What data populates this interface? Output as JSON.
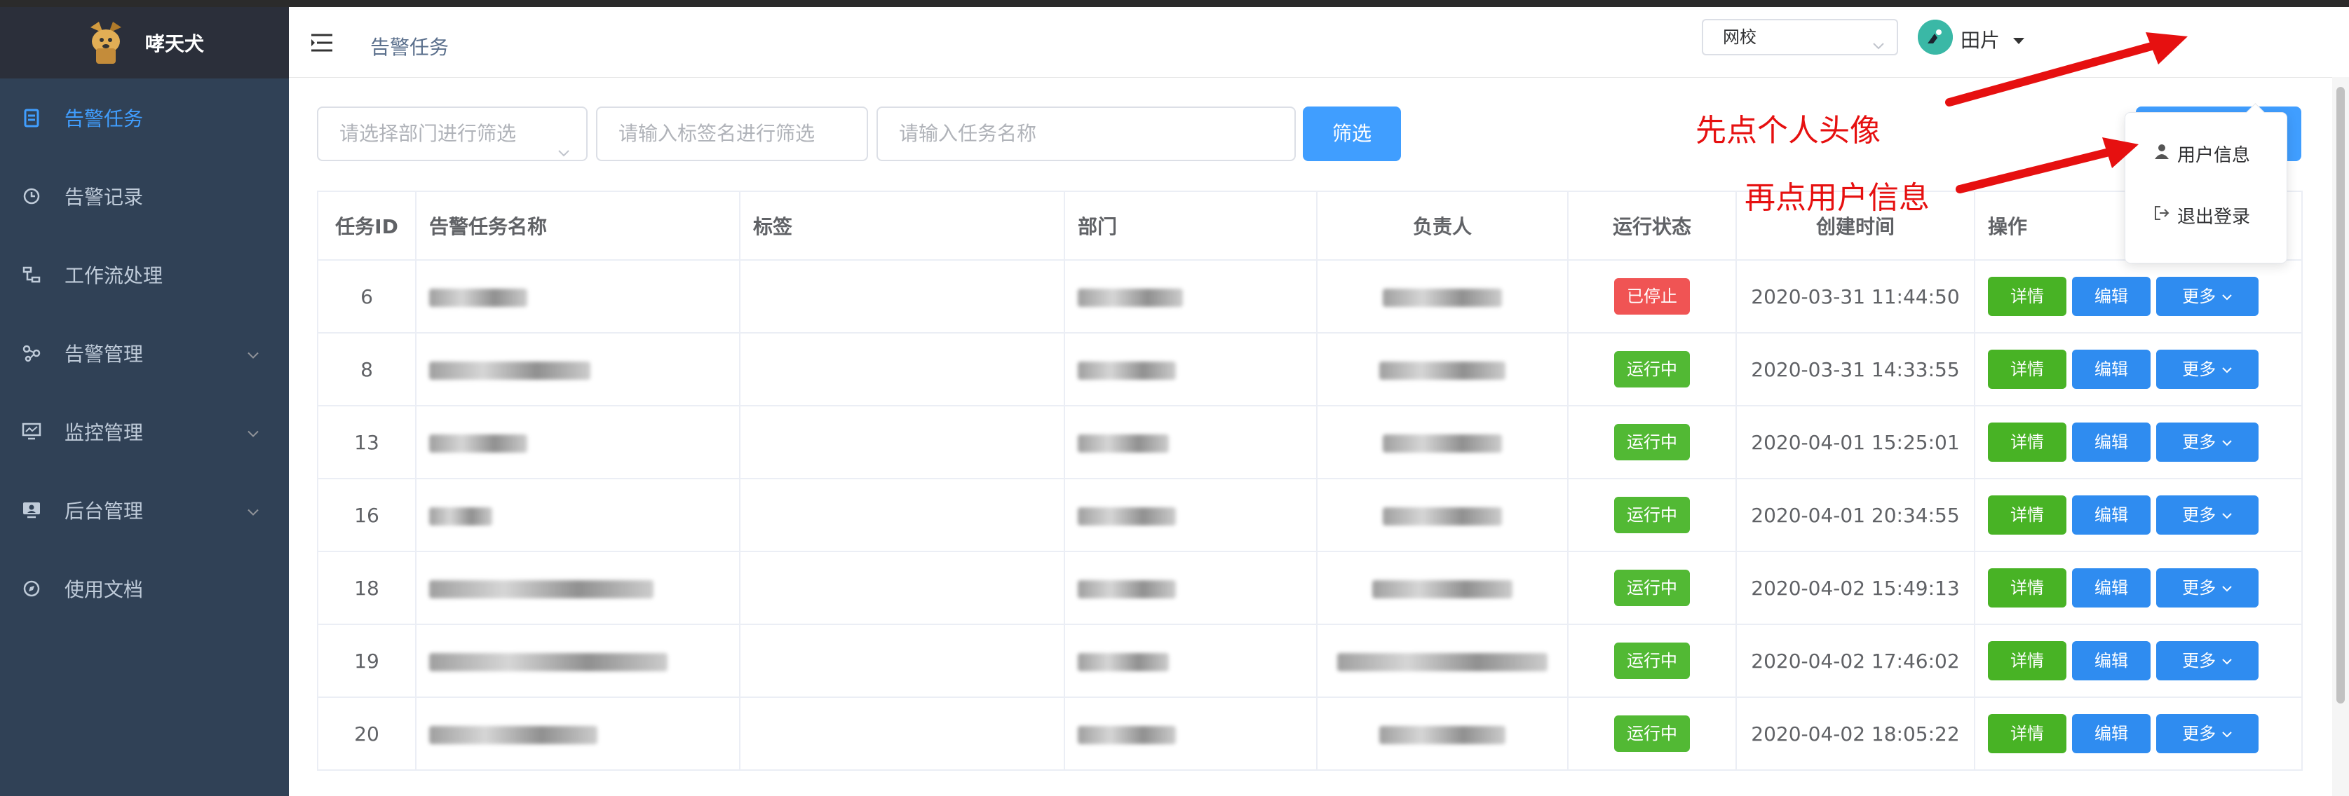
{
  "brand": {
    "title": "哮天犬",
    "logo": "dog-logo"
  },
  "sidebar": {
    "items": [
      {
        "label": "告警任务",
        "icon": "clipboard-icon",
        "active": true
      },
      {
        "label": "告警记录",
        "icon": "clock-icon"
      },
      {
        "label": "工作流处理",
        "icon": "workflow-icon"
      },
      {
        "label": "告警管理",
        "icon": "nodes-icon",
        "has_children": true
      },
      {
        "label": "监控管理",
        "icon": "monitor-icon",
        "has_children": true
      },
      {
        "label": "后台管理",
        "icon": "screen-user-icon",
        "has_children": true
      },
      {
        "label": "使用文档",
        "icon": "compass-icon"
      }
    ]
  },
  "header": {
    "breadcrumb": "告警任务",
    "school_select": "网校",
    "user_name": "田片"
  },
  "filters": {
    "department_placeholder": "请选择部门进行筛选",
    "tag_placeholder": "请输入标签名进行筛选",
    "task_placeholder": "请输入任务名称",
    "button": "筛选"
  },
  "table": {
    "columns": [
      "任务ID",
      "告警任务名称",
      "标签",
      "部门",
      "负责人",
      "运行状态",
      "创建时间",
      "操作"
    ],
    "rows": [
      {
        "id": "6",
        "status": "已停止",
        "status_type": "stopped",
        "created": "2020-03-31 11:44:50"
      },
      {
        "id": "8",
        "status": "运行中",
        "status_type": "running",
        "created": "2020-03-31 14:33:55"
      },
      {
        "id": "13",
        "status": "运行中",
        "status_type": "running",
        "created": "2020-04-01 15:25:01"
      },
      {
        "id": "16",
        "status": "运行中",
        "status_type": "running",
        "created": "2020-04-01 20:34:55"
      },
      {
        "id": "18",
        "status": "运行中",
        "status_type": "running",
        "created": "2020-04-02 15:49:13"
      },
      {
        "id": "19",
        "status": "运行中",
        "status_type": "running",
        "created": "2020-04-02 17:46:02"
      },
      {
        "id": "20",
        "status": "运行中",
        "status_type": "running",
        "created": "2020-04-02 18:05:22"
      }
    ],
    "actions": {
      "detail": "详情",
      "edit": "编辑",
      "more": "更多"
    }
  },
  "dropdown": {
    "user_info": "用户信息",
    "logout": "退出登录"
  },
  "annotations": {
    "step1": "先点个人头像",
    "step2": "再点用户信息"
  },
  "colors": {
    "sidebar_bg": "#304156",
    "active": "#409eff",
    "running": "#52b934",
    "stopped": "#f05454",
    "annotation": "#e61010"
  }
}
